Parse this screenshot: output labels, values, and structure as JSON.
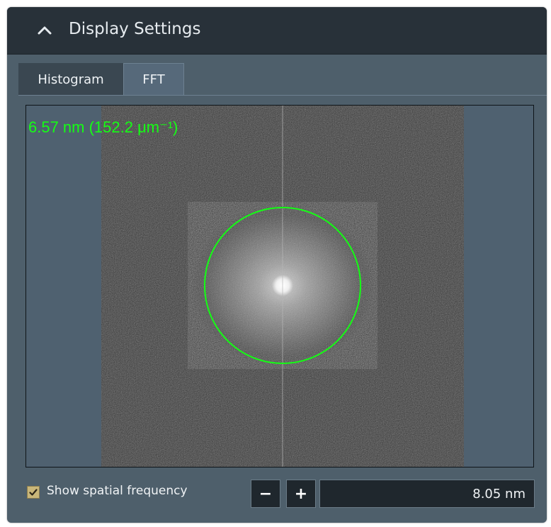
{
  "panel": {
    "title": "Display Settings",
    "collapse_icon": "chevron-up-icon"
  },
  "tabs": [
    {
      "label": "Histogram",
      "active": false
    },
    {
      "label": "FFT",
      "active": true
    }
  ],
  "fft": {
    "readout": "6.57 nm (152.2 μm⁻¹)",
    "overlay_color": "#14ff14"
  },
  "controls": {
    "show_spatial_frequency": {
      "label": "Show spatial frequency",
      "checked": true
    },
    "decrement_label": "−",
    "increment_label": "+",
    "value": "8.05 nm"
  },
  "colors": {
    "header_bg": "#283139",
    "panel_bg": "#4e5f6b",
    "accent_check": "#c9b679"
  }
}
